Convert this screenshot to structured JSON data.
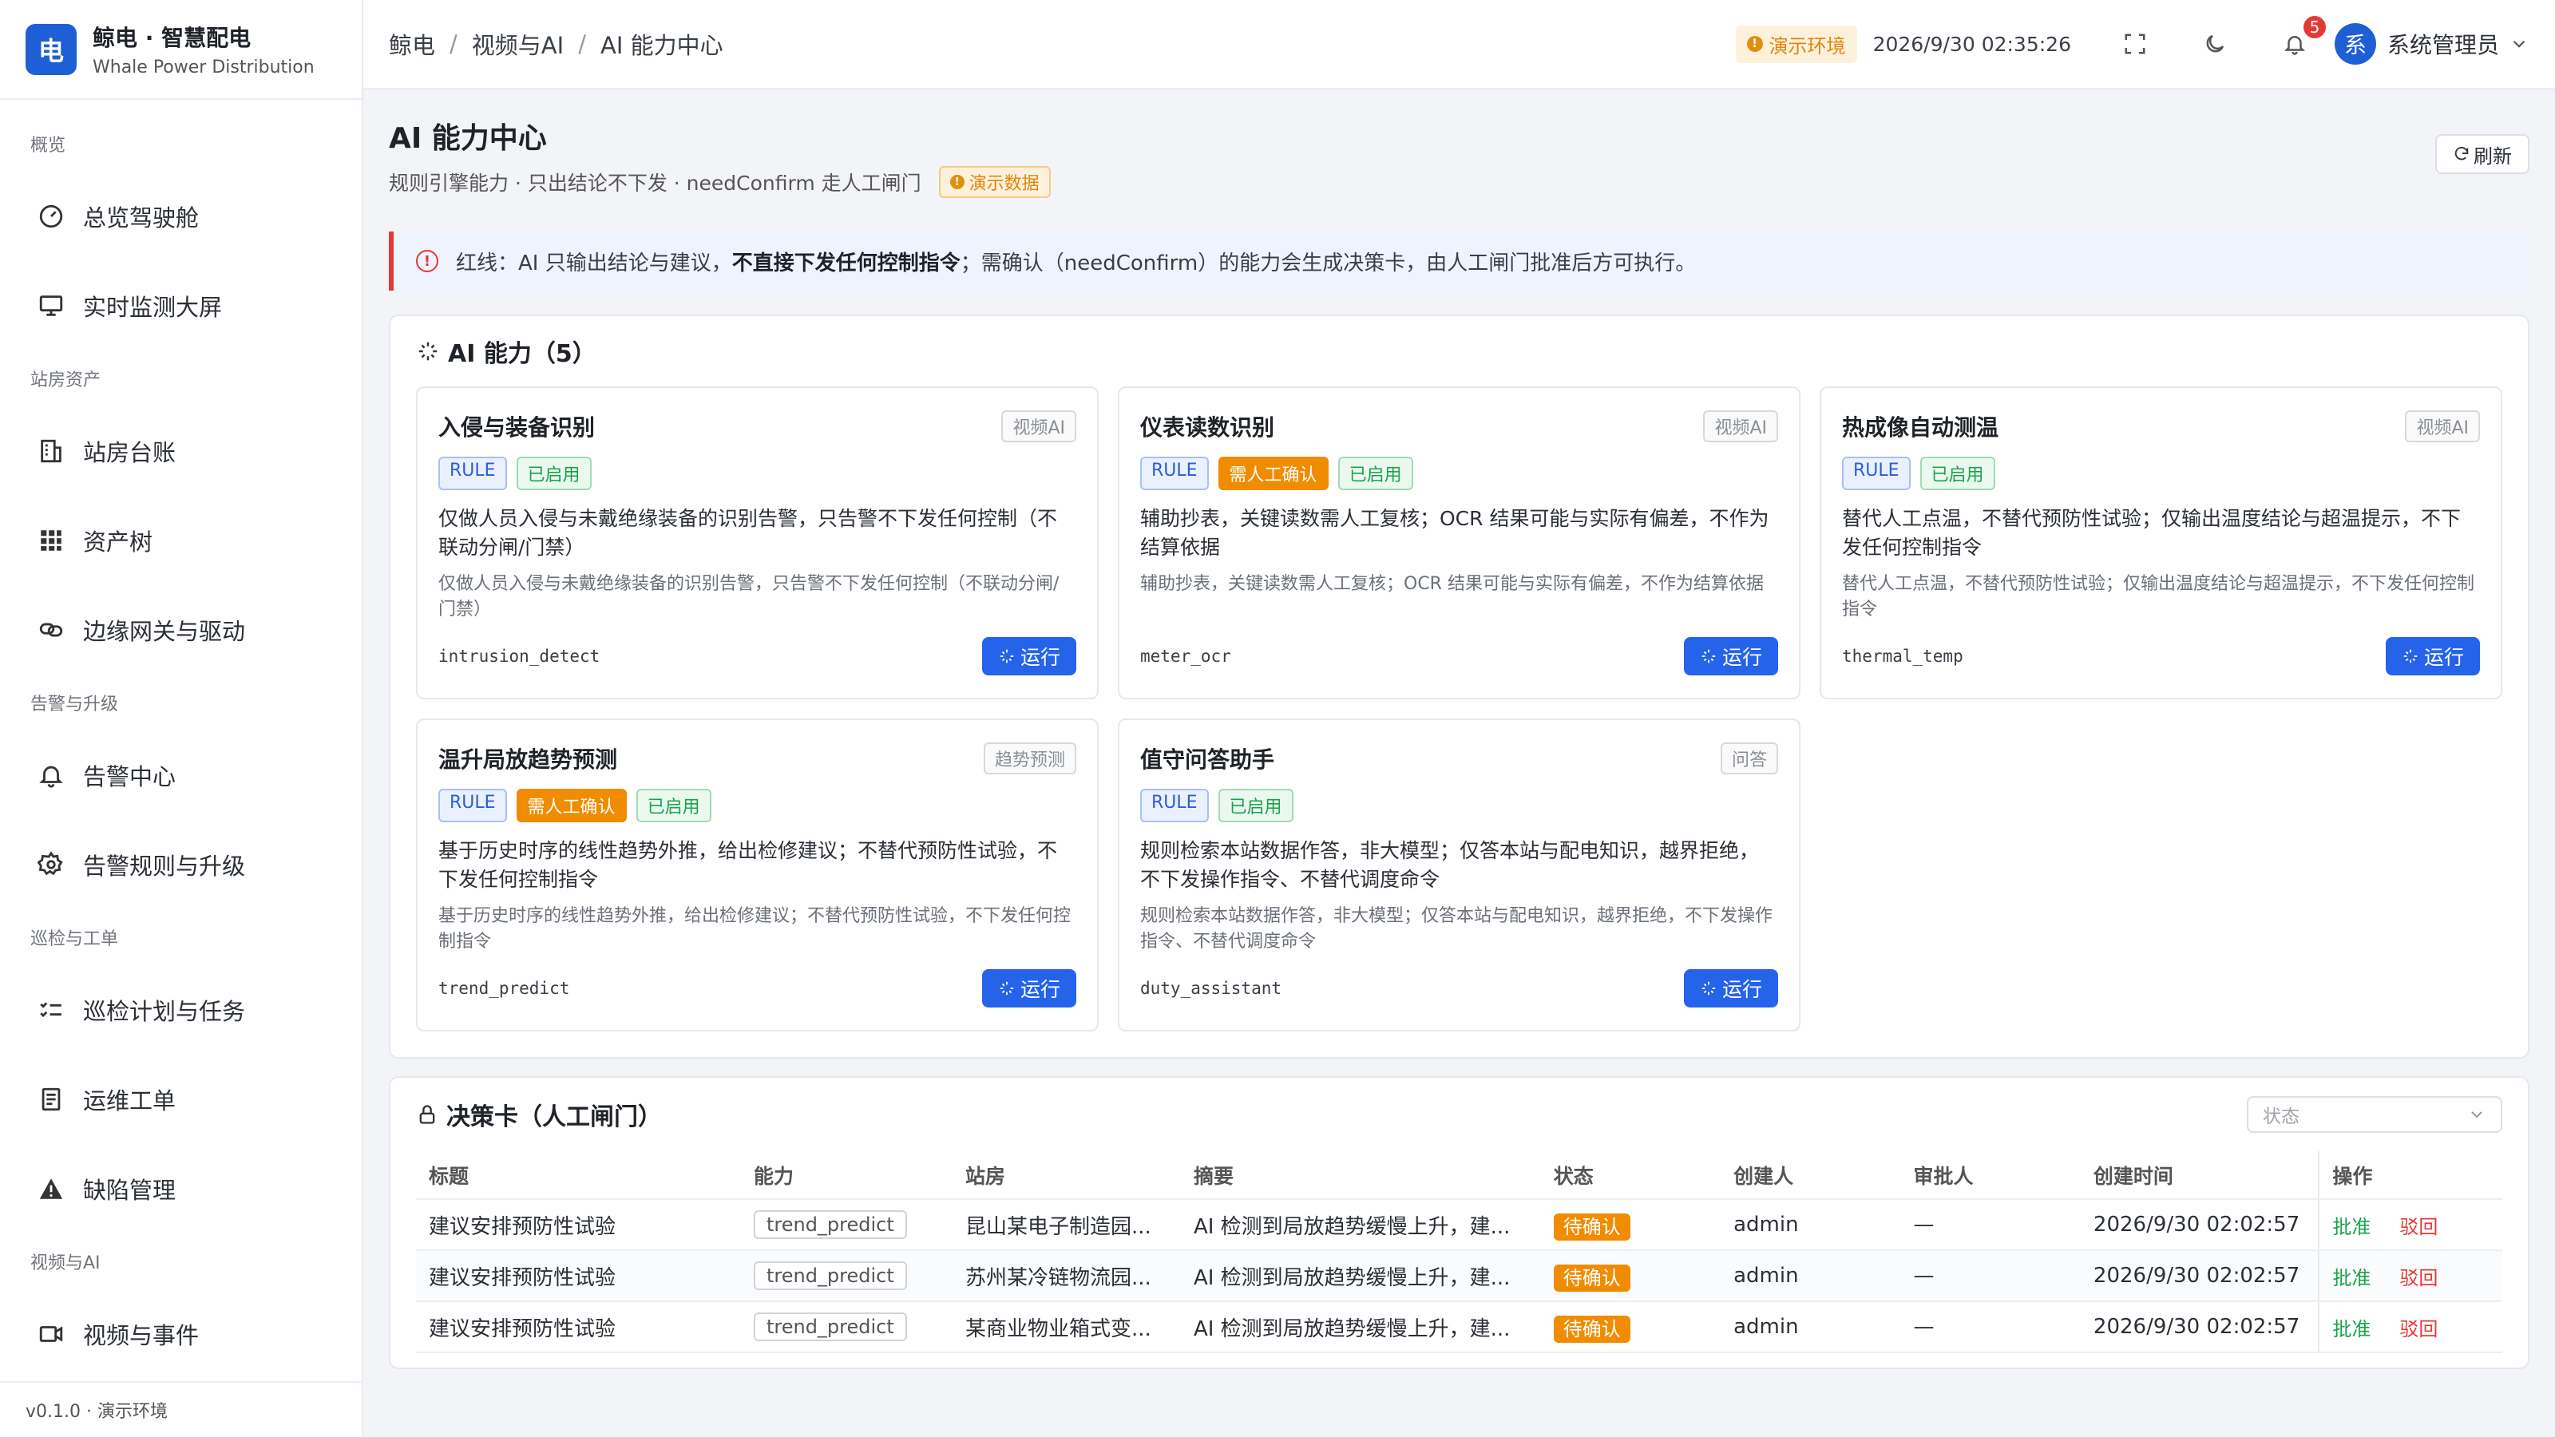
{
  "brand": {
    "logo": "电",
    "name": "鲸电 · 智慧配电",
    "sub": "Whale Power Distribution"
  },
  "sidebar": {
    "groups": [
      {
        "label": "概览",
        "items": [
          {
            "label": "总览驾驶舱",
            "icon": "dashboard-icon"
          },
          {
            "label": "实时监测大屏",
            "icon": "monitor-icon"
          }
        ]
      },
      {
        "label": "站房资产",
        "items": [
          {
            "label": "站房台账",
            "icon": "building-icon"
          },
          {
            "label": "资产树",
            "icon": "grid-icon"
          },
          {
            "label": "边缘网关与驱动",
            "icon": "link-icon"
          }
        ]
      },
      {
        "label": "告警与升级",
        "items": [
          {
            "label": "告警中心",
            "icon": "bell-icon"
          },
          {
            "label": "告警规则与升级",
            "icon": "gear-icon"
          }
        ]
      },
      {
        "label": "巡检与工单",
        "items": [
          {
            "label": "巡检计划与任务",
            "icon": "checklist-icon"
          },
          {
            "label": "运维工单",
            "icon": "document-icon"
          },
          {
            "label": "缺陷管理",
            "icon": "warning-icon"
          }
        ]
      },
      {
        "label": "视频与AI",
        "items": [
          {
            "label": "视频与事件",
            "icon": "video-icon"
          }
        ]
      }
    ],
    "footer": "v0.1.0 · 演示环境"
  },
  "header": {
    "breadcrumb": [
      "鲸电",
      "视频与AI",
      "AI 能力中心"
    ],
    "env_tag": "演示环境",
    "clock": "2026/9/30 02:35:26",
    "notifications": "5",
    "avatar": "系",
    "user": "系统管理员"
  },
  "page": {
    "title": "AI 能力中心",
    "subtitle": "规则引擎能力 · 只出结论不下发 · needConfirm 走人工闸门",
    "demo_tag": "演示数据",
    "refresh": "刷新",
    "alert_prefix": "红线：AI 只输出结论与建议，",
    "alert_bold": "不直接下发任何控制指令",
    "alert_suffix": "；需确认（needConfirm）的能力会生成决策卡，由人工闸门批准后方可执行。"
  },
  "capabilities": {
    "title": "AI 能力（5）",
    "run_label": "运行",
    "items": [
      {
        "title": "入侵与装备识别",
        "type": "视频AI",
        "tags": [
          "RULE",
          "已启用"
        ],
        "need_confirm": false,
        "desc": "仅做人员入侵与未戴绝缘装备的识别告警，只告警不下发任何控制（不联动分闸/门禁）",
        "detail": "仅做人员入侵与未戴绝缘装备的识别告警，只告警不下发任何控制（不联动分闸/门禁）",
        "code": "intrusion_detect"
      },
      {
        "title": "仪表读数识别",
        "type": "视频AI",
        "tags": [
          "RULE",
          "需人工确认",
          "已启用"
        ],
        "need_confirm": true,
        "desc": "辅助抄表，关键读数需人工复核；OCR 结果可能与实际有偏差，不作为结算依据",
        "detail": "辅助抄表，关键读数需人工复核；OCR 结果可能与实际有偏差，不作为结算依据",
        "code": "meter_ocr"
      },
      {
        "title": "热成像自动测温",
        "type": "视频AI",
        "tags": [
          "RULE",
          "已启用"
        ],
        "need_confirm": false,
        "desc": "替代人工点温，不替代预防性试验；仅输出温度结论与超温提示，不下发任何控制指令",
        "detail": "替代人工点温，不替代预防性试验；仅输出温度结论与超温提示，不下发任何控制指令",
        "code": "thermal_temp"
      },
      {
        "title": "温升局放趋势预测",
        "type": "趋势预测",
        "tags": [
          "RULE",
          "需人工确认",
          "已启用"
        ],
        "need_confirm": true,
        "desc": "基于历史时序的线性趋势外推，给出检修建议；不替代预防性试验，不下发任何控制指令",
        "detail": "基于历史时序的线性趋势外推，给出检修建议；不替代预防性试验，不下发任何控制指令",
        "code": "trend_predict"
      },
      {
        "title": "值守问答助手",
        "type": "问答",
        "tags": [
          "RULE",
          "已启用"
        ],
        "need_confirm": false,
        "desc": "规则检索本站数据作答，非大模型；仅答本站与配电知识，越界拒绝，不下发操作指令、不替代调度命令",
        "detail": "规则检索本站数据作答，非大模型；仅答本站与配电知识，越界拒绝，不下发操作指令、不替代调度命令",
        "code": "duty_assistant"
      }
    ]
  },
  "decisions": {
    "title": "决策卡（人工闸门）",
    "status_placeholder": "状态",
    "columns": [
      "标题",
      "能力",
      "站房",
      "摘要",
      "状态",
      "创建人",
      "审批人",
      "创建时间",
      "操作"
    ],
    "approve": "批准",
    "reject": "驳回",
    "rows": [
      {
        "title": "建议安排预防性试验",
        "capability": "trend_predict",
        "station": "昆山某电子制造园...",
        "summary": "AI 检测到局放趋势缓慢上升，建...",
        "status": "待确认",
        "creator": "admin",
        "approver": "—",
        "created": "2026/9/30 02:02:57"
      },
      {
        "title": "建议安排预防性试验",
        "capability": "trend_predict",
        "station": "苏州某冷链物流园...",
        "summary": "AI 检测到局放趋势缓慢上升，建...",
        "status": "待确认",
        "creator": "admin",
        "approver": "—",
        "created": "2026/9/30 02:02:57"
      },
      {
        "title": "建议安排预防性试验",
        "capability": "trend_predict",
        "station": "某商业物业箱式变...",
        "summary": "AI 检测到局放趋势缓慢上升，建...",
        "status": "待确认",
        "creator": "admin",
        "approver": "—",
        "created": "2026/9/30 02:02:57"
      }
    ]
  },
  "colors": {
    "primary": "#2563eb",
    "warning": "#f08c00",
    "success": "#1aa34a",
    "danger": "#e53935"
  }
}
